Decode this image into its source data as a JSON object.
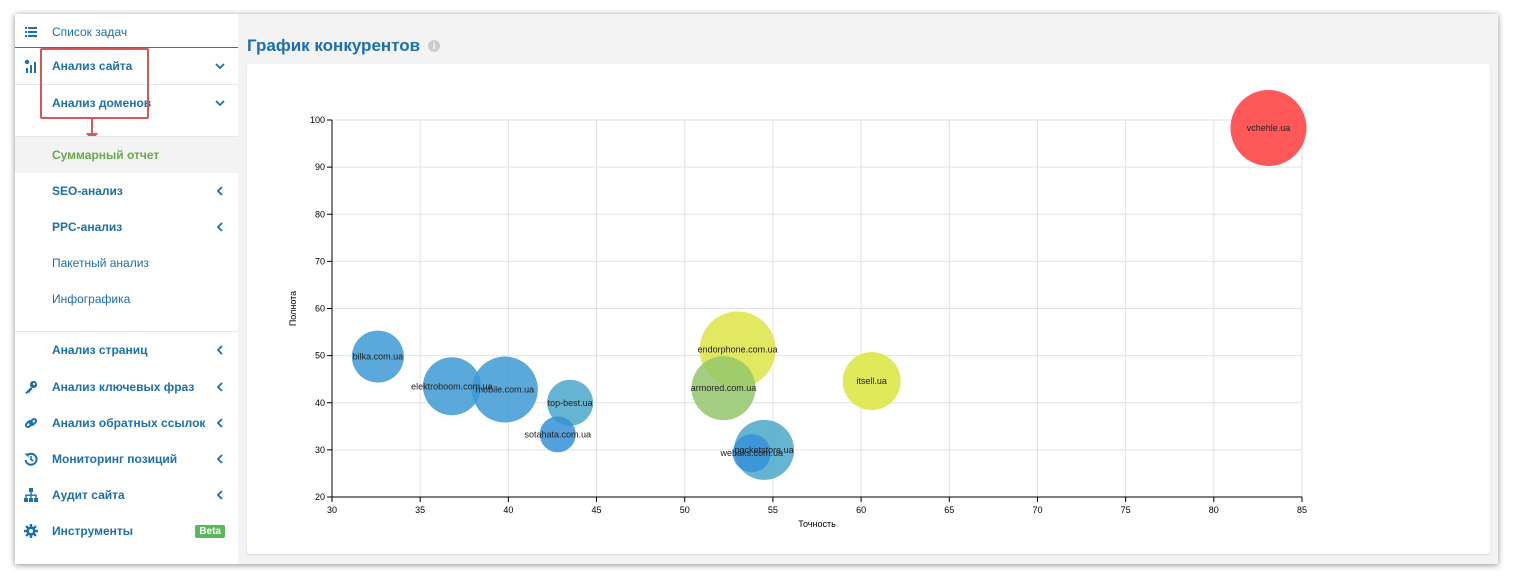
{
  "sidebar": {
    "task_list": "Список задач",
    "site_analysis": "Анализ сайта",
    "domain_analysis": "Анализ доменов",
    "sub_items": [
      {
        "label": "Суммарный отчет",
        "active": true
      },
      {
        "label": "SEO-анализ",
        "bold": true,
        "chevron": true
      },
      {
        "label": "PPC-анализ",
        "bold": true,
        "chevron": true
      },
      {
        "label": "Пакетный анализ",
        "bold": false,
        "chevron": false
      },
      {
        "label": "Инфографика",
        "bold": false,
        "chevron": false
      }
    ],
    "page_analysis": "Анализ страниц",
    "sections": [
      {
        "label": "Анализ ключевых фраз",
        "icon": "key-icon"
      },
      {
        "label": "Анализ обратных ссылок",
        "icon": "link-icon"
      },
      {
        "label": "Мониторинг позиций",
        "icon": "history-icon"
      },
      {
        "label": "Аудит сайта",
        "icon": "sitemap-icon"
      },
      {
        "label": "Инструменты",
        "icon": "gear-icon",
        "badge": "Beta"
      }
    ]
  },
  "main": {
    "title": "График конкурентов",
    "info": "i"
  },
  "colors": {
    "accent": "#1c6fb1",
    "active": "#6aa94a",
    "highlight": "#d85757",
    "beta": "#5cb85c"
  },
  "chart_data": {
    "type": "scatter",
    "xlabel": "Точность",
    "ylabel": "Полнота",
    "xlim": [
      30,
      85
    ],
    "ylim": [
      20,
      100
    ],
    "xticks": [
      30,
      35,
      40,
      45,
      50,
      55,
      60,
      65,
      70,
      75,
      80,
      85
    ],
    "yticks": [
      20,
      30,
      40,
      50,
      60,
      70,
      80,
      90,
      100
    ],
    "grid": true,
    "points": [
      {
        "label": "vchehle.ua",
        "x": 83.1,
        "y": 98.3,
        "size": 38,
        "color": "#ff3b3b"
      },
      {
        "label": "endorphone.com.ua",
        "x": 53.0,
        "y": 51.3,
        "size": 38,
        "color": "#dde444"
      },
      {
        "label": "itsell.ua",
        "x": 60.6,
        "y": 44.6,
        "size": 29,
        "color": "#d9e53c"
      },
      {
        "label": "armored.com.ua",
        "x": 52.2,
        "y": 43.1,
        "size": 32,
        "color": "#94c76c"
      },
      {
        "label": "bilka.com.ua",
        "x": 32.6,
        "y": 49.8,
        "size": 26,
        "color": "#3d9ad3"
      },
      {
        "label": "elektroboom.com.ua",
        "x": 36.8,
        "y": 43.5,
        "size": 29,
        "color": "#3d9ad3"
      },
      {
        "label": "mobile.com.ua",
        "x": 39.8,
        "y": 42.8,
        "size": 33,
        "color": "#3d9ad3"
      },
      {
        "label": "top-best.ua",
        "x": 43.5,
        "y": 40.0,
        "size": 23,
        "color": "#4aa7c9"
      },
      {
        "label": "sotahata.com.ua",
        "x": 42.8,
        "y": 33.3,
        "size": 18,
        "color": "#3690d8"
      },
      {
        "label": "pocketstore.ua",
        "x": 54.5,
        "y": 30.0,
        "size": 30,
        "color": "#4aa7c9"
      },
      {
        "label": "webaks.com.ua",
        "x": 53.8,
        "y": 29.3,
        "size": 19,
        "color": "#3690d8"
      }
    ]
  }
}
